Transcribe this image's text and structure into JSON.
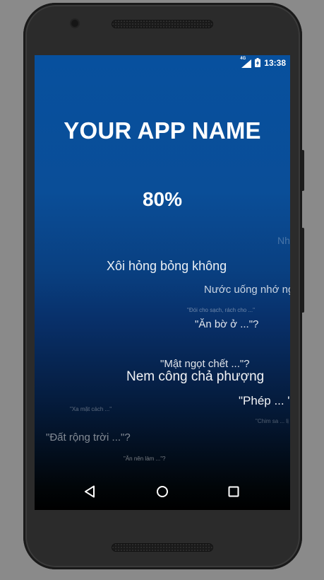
{
  "status_bar": {
    "network": "4G",
    "time": "13:38",
    "icons": [
      "signal-icon",
      "battery-charging-icon"
    ]
  },
  "app": {
    "title": "YOUR APP NAME",
    "progress_text": "80%",
    "progress_value": 0.8
  },
  "floating_texts": [
    "Nh",
    "Xôi hỏng bỏng không",
    "Nước uống nhớ ng",
    "\"Đói cho sạch, rách cho ...\"",
    "\"Ăn bờ ở ...\"?",
    "\"Mật ngọt chết ...\"?",
    "Nem công chả phượng",
    "\"Phép ... \"",
    "\"Xa mặt cách ...\"",
    "\"Chim sa ... lị",
    "\"Đất rộng trời ...\"?",
    "\"Ăn nên làm ...\"?"
  ],
  "nav_bar": {
    "buttons": [
      "back-icon",
      "home-icon",
      "recents-icon"
    ]
  }
}
